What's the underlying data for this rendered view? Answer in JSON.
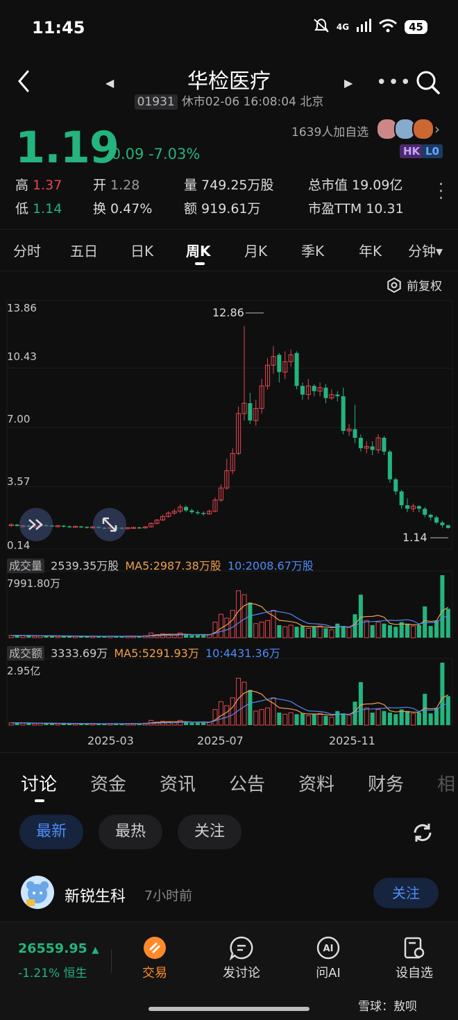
{
  "status": {
    "time": "11:45",
    "network": "4G",
    "battery": "45"
  },
  "header": {
    "title": "华检医疗",
    "code": "01931",
    "subtitle": "休市02-06 16:08:04 北京"
  },
  "quote": {
    "price": "1.19",
    "change": "-0.09 -7.03%",
    "watchers": "1639人加自选",
    "tags": [
      "HK",
      "L0"
    ],
    "colors": {
      "down": "#24b47e",
      "up": "#e5484d"
    },
    "stats": [
      {
        "label": "高",
        "value": "1.37",
        "color": "red"
      },
      {
        "label": "开",
        "value": "1.28",
        "color": "muted"
      },
      {
        "label": "量",
        "value": "749.25万股",
        "color": "white"
      },
      {
        "label": "总市值",
        "value": "19.09亿",
        "color": "white"
      },
      {
        "label": "低",
        "value": "1.14",
        "color": "green"
      },
      {
        "label": "换",
        "value": "0.47%",
        "color": "white"
      },
      {
        "label": "额",
        "value": "919.61万",
        "color": "white"
      },
      {
        "label": "市盈TTM",
        "value": "10.31",
        "color": "white"
      }
    ]
  },
  "period_tabs": [
    "分时",
    "五日",
    "日K",
    "周K",
    "月K",
    "季K",
    "年K",
    "分钟▾"
  ],
  "active_period": "周K",
  "adjust_label": "前复权",
  "chart_data": {
    "type": "candlestick",
    "price_axis": {
      "ticks": [
        "13.86",
        "10.43",
        "7.00",
        "3.57",
        "0.14"
      ],
      "ylim": [
        0.14,
        13.86
      ]
    },
    "max_label": "12.86",
    "min_label": "1.14",
    "x_ticks": [
      "2025-03",
      "2025-07",
      "2025-11"
    ],
    "candles": [
      [
        1.35,
        1.38,
        1.25,
        1.45
      ],
      [
        1.38,
        1.3,
        1.28,
        1.42
      ],
      [
        1.3,
        1.32,
        1.22,
        1.38
      ],
      [
        1.32,
        1.28,
        1.22,
        1.36
      ],
      [
        1.28,
        1.3,
        1.2,
        1.35
      ],
      [
        1.3,
        1.35,
        1.25,
        1.4
      ],
      [
        1.35,
        1.33,
        1.28,
        1.38
      ],
      [
        1.33,
        1.3,
        1.25,
        1.36
      ],
      [
        1.3,
        1.32,
        1.24,
        1.36
      ],
      [
        1.32,
        1.28,
        1.22,
        1.35
      ],
      [
        1.28,
        1.26,
        1.2,
        1.32
      ],
      [
        1.26,
        1.28,
        1.2,
        1.32
      ],
      [
        1.28,
        1.25,
        1.18,
        1.3
      ],
      [
        1.25,
        1.22,
        1.15,
        1.28
      ],
      [
        1.22,
        1.25,
        1.15,
        1.3
      ],
      [
        1.25,
        1.2,
        1.14,
        1.28
      ],
      [
        1.2,
        1.18,
        1.12,
        1.24
      ],
      [
        1.18,
        1.22,
        1.12,
        1.26
      ],
      [
        1.22,
        1.2,
        1.15,
        1.26
      ],
      [
        1.2,
        1.18,
        1.12,
        1.24
      ],
      [
        1.18,
        1.2,
        1.12,
        1.24
      ],
      [
        1.2,
        1.22,
        1.15,
        1.26
      ],
      [
        1.22,
        1.2,
        1.15,
        1.26
      ],
      [
        1.2,
        1.25,
        1.15,
        1.3
      ],
      [
        1.25,
        1.45,
        1.22,
        1.5
      ],
      [
        1.45,
        1.65,
        1.4,
        1.7
      ],
      [
        1.65,
        1.85,
        1.6,
        1.95
      ],
      [
        1.85,
        2.05,
        1.8,
        2.15
      ],
      [
        2.05,
        2.15,
        1.95,
        2.3
      ],
      [
        2.15,
        2.4,
        2.05,
        2.55
      ],
      [
        2.4,
        2.2,
        2.1,
        2.5
      ],
      [
        2.2,
        2.1,
        2.0,
        2.3
      ],
      [
        2.1,
        2.05,
        1.95,
        2.2
      ],
      [
        2.05,
        2.0,
        1.9,
        2.15
      ],
      [
        2.0,
        2.15,
        1.95,
        2.25
      ],
      [
        2.15,
        2.8,
        2.1,
        2.95
      ],
      [
        2.8,
        3.5,
        2.7,
        3.7
      ],
      [
        3.5,
        4.5,
        3.4,
        5.2
      ],
      [
        4.5,
        5.5,
        4.3,
        5.8
      ],
      [
        5.5,
        7.8,
        5.4,
        8.2
      ],
      [
        7.8,
        8.4,
        7.4,
        12.86
      ],
      [
        8.4,
        7.4,
        7.2,
        9.0
      ],
      [
        7.4,
        8.1,
        7.1,
        8.6
      ],
      [
        8.1,
        9.4,
        7.8,
        9.8
      ],
      [
        9.4,
        10.6,
        9.2,
        11.0
      ],
      [
        10.6,
        11.1,
        10.1,
        11.7
      ],
      [
        11.2,
        10.2,
        9.6,
        11.3
      ],
      [
        10.2,
        10.8,
        9.8,
        11.4
      ],
      [
        10.8,
        11.2,
        10.5,
        11.5
      ],
      [
        11.3,
        9.4,
        9.2,
        11.4
      ],
      [
        9.4,
        8.9,
        8.6,
        9.6
      ],
      [
        8.9,
        9.4,
        8.6,
        9.8
      ],
      [
        9.4,
        9.1,
        8.8,
        9.5
      ],
      [
        9.1,
        9.3,
        8.8,
        9.6
      ],
      [
        9.3,
        8.7,
        8.4,
        9.5
      ],
      [
        8.7,
        8.9,
        8.6,
        9.2
      ],
      [
        8.9,
        8.8,
        8.5,
        9.1
      ],
      [
        8.8,
        6.8,
        6.6,
        9.3
      ],
      [
        6.8,
        6.9,
        6.5,
        7.2
      ],
      [
        6.9,
        6.4,
        6.1,
        8.3
      ],
      [
        6.4,
        5.8,
        5.6,
        6.6
      ],
      [
        5.8,
        5.9,
        5.5,
        6.2
      ],
      [
        5.9,
        5.7,
        5.4,
        6.2
      ],
      [
        5.7,
        6.4,
        5.5,
        6.6
      ],
      [
        6.4,
        5.6,
        5.4,
        6.5
      ],
      [
        5.6,
        4.0,
        3.8,
        5.7
      ],
      [
        4.0,
        3.3,
        3.1,
        4.1
      ],
      [
        3.3,
        2.5,
        2.3,
        3.4
      ],
      [
        2.5,
        2.3,
        2.1,
        2.9
      ],
      [
        2.3,
        2.45,
        2.1,
        2.6
      ],
      [
        2.45,
        2.3,
        2.1,
        2.5
      ],
      [
        2.3,
        1.95,
        1.8,
        2.4
      ],
      [
        1.95,
        1.8,
        1.6,
        2.0
      ],
      [
        1.8,
        1.5,
        1.4,
        1.9
      ],
      [
        1.5,
        1.35,
        1.2,
        1.6
      ],
      [
        1.35,
        1.19,
        1.14,
        1.37
      ]
    ]
  },
  "volume": {
    "title": "成交量",
    "current": "2539.35万股",
    "ma5": "MA5:2987.38万股",
    "ma10": "10:2008.67万股",
    "max_label": "7991.80万",
    "values": [
      0.3,
      0.3,
      0.25,
      0.25,
      0.2,
      0.25,
      0.2,
      0.2,
      0.2,
      0.2,
      0.15,
      0.2,
      0.2,
      0.15,
      0.2,
      0.15,
      0.15,
      0.2,
      0.2,
      0.15,
      0.2,
      0.2,
      0.15,
      0.25,
      0.6,
      0.4,
      0.5,
      0.4,
      0.3,
      0.6,
      0.4,
      0.3,
      0.3,
      0.3,
      0.4,
      2.0,
      3.0,
      2.5,
      3.5,
      6.0,
      5.5,
      4.5,
      1.8,
      2.0,
      2.2,
      3.5,
      1.6,
      1.4,
      1.6,
      1.4,
      1.5,
      1.2,
      1.4,
      1.5,
      1.2,
      1.0,
      1.8,
      1.5,
      1.3,
      3.0,
      5.5,
      2.2,
      1.6,
      2.0,
      1.8,
      1.6,
      1.4,
      2.0,
      1.8,
      1.5,
      1.6,
      4.0,
      1.5,
      2.2,
      7.99,
      3.7
    ]
  },
  "amount": {
    "title": "成交额",
    "current": "3333.69万",
    "ma5": "MA5:5291.93万",
    "ma10": "10:4431.36万",
    "max_label": "2.95亿"
  },
  "content_tabs": [
    "讨论",
    "资金",
    "资讯",
    "公告",
    "资料",
    "财务",
    "相"
  ],
  "filters": [
    "最新",
    "最热",
    "关注"
  ],
  "post": {
    "user": "新锐生科",
    "time": "7小时前",
    "follow": "关注"
  },
  "index": {
    "value": "26559.95",
    "change": "-1.21% 恒生"
  },
  "bottom_nav": [
    "交易",
    "发讨论",
    "问AI",
    "设自选"
  ],
  "watermark": "雪球：敖呗"
}
